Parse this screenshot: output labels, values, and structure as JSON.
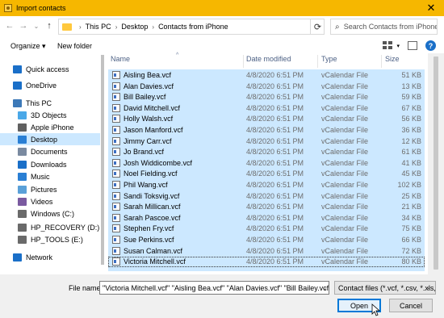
{
  "window": {
    "title": "Import contacts",
    "close_glyph": "✕"
  },
  "nav": {
    "back": "←",
    "forward": "→",
    "recent": "⌄",
    "up": "↑"
  },
  "address": {
    "crumbs": [
      "This PC",
      "Desktop",
      "Contacts from iPhone"
    ],
    "separator": "›",
    "refresh": "⟳"
  },
  "search": {
    "placeholder": "Search Contacts from iPhone"
  },
  "toolbar": {
    "organize": "Organize ▾",
    "new_folder": "New folder"
  },
  "navpane": {
    "items": [
      {
        "label": "Quick access",
        "icon": "star-icon",
        "color": "#1a6fc8"
      },
      {
        "label": "OneDrive",
        "icon": "cloud-icon",
        "color": "#1a6fc8"
      },
      {
        "label": "This PC",
        "icon": "computer-icon",
        "color": "#3d79b8"
      },
      {
        "label": "3D Objects",
        "icon": "cube-icon",
        "color": "#4aa8e8"
      },
      {
        "label": "Apple iPhone",
        "icon": "phone-icon",
        "color": "#606060"
      },
      {
        "label": "Desktop",
        "icon": "desktop-icon",
        "color": "#2a7fd4"
      },
      {
        "label": "Documents",
        "icon": "document-icon",
        "color": "#7a8aa0"
      },
      {
        "label": "Downloads",
        "icon": "download-icon",
        "color": "#1a6fc8"
      },
      {
        "label": "Music",
        "icon": "music-icon",
        "color": "#2a7fd4"
      },
      {
        "label": "Pictures",
        "icon": "picture-icon",
        "color": "#5aa0d8"
      },
      {
        "label": "Videos",
        "icon": "video-icon",
        "color": "#7a5aa0"
      },
      {
        "label": "Windows (C:)",
        "icon": "drive-icon",
        "color": "#6a6a6a"
      },
      {
        "label": "HP_RECOVERY (D:)",
        "icon": "drive-icon",
        "color": "#6a6a6a"
      },
      {
        "label": "HP_TOOLS (E:)",
        "icon": "drive-icon",
        "color": "#6a6a6a"
      },
      {
        "label": "Network",
        "icon": "network-icon",
        "color": "#1a6fc8"
      }
    ]
  },
  "columns": {
    "name": "Name",
    "date": "Date modified",
    "type": "Type",
    "size": "Size"
  },
  "files": [
    {
      "name": "Aisling Bea.vcf",
      "date": "4/8/2020 6:51 PM",
      "type": "vCalendar File",
      "size": "51 KB"
    },
    {
      "name": "Alan Davies.vcf",
      "date": "4/8/2020 6:51 PM",
      "type": "vCalendar File",
      "size": "13 KB"
    },
    {
      "name": "Bill Bailey.vcf",
      "date": "4/8/2020 6:51 PM",
      "type": "vCalendar File",
      "size": "59 KB"
    },
    {
      "name": "David Mitchell.vcf",
      "date": "4/8/2020 6:51 PM",
      "type": "vCalendar File",
      "size": "67 KB"
    },
    {
      "name": "Holly Walsh.vcf",
      "date": "4/8/2020 6:51 PM",
      "type": "vCalendar File",
      "size": "56 KB"
    },
    {
      "name": "Jason Manford.vcf",
      "date": "4/8/2020 6:51 PM",
      "type": "vCalendar File",
      "size": "36 KB"
    },
    {
      "name": "Jimmy Carr.vcf",
      "date": "4/8/2020 6:51 PM",
      "type": "vCalendar File",
      "size": "12 KB"
    },
    {
      "name": "Jo Brand.vcf",
      "date": "4/8/2020 6:51 PM",
      "type": "vCalendar File",
      "size": "61 KB"
    },
    {
      "name": "Josh Widdicombe.vcf",
      "date": "4/8/2020 6:51 PM",
      "type": "vCalendar File",
      "size": "41 KB"
    },
    {
      "name": "Noel Fielding.vcf",
      "date": "4/8/2020 6:51 PM",
      "type": "vCalendar File",
      "size": "45 KB"
    },
    {
      "name": "Phil Wang.vcf",
      "date": "4/8/2020 6:51 PM",
      "type": "vCalendar File",
      "size": "102 KB"
    },
    {
      "name": "Sandi Toksvig.vcf",
      "date": "4/8/2020 6:51 PM",
      "type": "vCalendar File",
      "size": "25 KB"
    },
    {
      "name": "Sarah Millican.vcf",
      "date": "4/8/2020 6:51 PM",
      "type": "vCalendar File",
      "size": "21 KB"
    },
    {
      "name": "Sarah Pascoe.vcf",
      "date": "4/8/2020 6:51 PM",
      "type": "vCalendar File",
      "size": "34 KB"
    },
    {
      "name": "Stephen Fry.vcf",
      "date": "4/8/2020 6:51 PM",
      "type": "vCalendar File",
      "size": "75 KB"
    },
    {
      "name": "Sue Perkins.vcf",
      "date": "4/8/2020 6:51 PM",
      "type": "vCalendar File",
      "size": "66 KB"
    },
    {
      "name": "Susan Calman.vcf",
      "date": "4/8/2020 6:51 PM",
      "type": "vCalendar File",
      "size": "72 KB"
    },
    {
      "name": "Victoria Mitchell.vcf",
      "date": "4/8/2020 6:51 PM",
      "type": "vCalendar File",
      "size": "80 KB"
    }
  ],
  "footer": {
    "file_name_label": "File name:",
    "file_name_value": "\"Victoria Mitchell.vcf\" \"Aisling Bea.vcf\" \"Alan Davies.vcf\" \"Bill Bailey.vcf\" \"David",
    "file_type": "Contact files (*.vcf, *.csv, *.xls, *.",
    "open": "Open",
    "cancel": "Cancel"
  },
  "colors": {
    "titlebar": "#f6b700",
    "selection": "#cce8ff",
    "accent": "#0078d7"
  }
}
